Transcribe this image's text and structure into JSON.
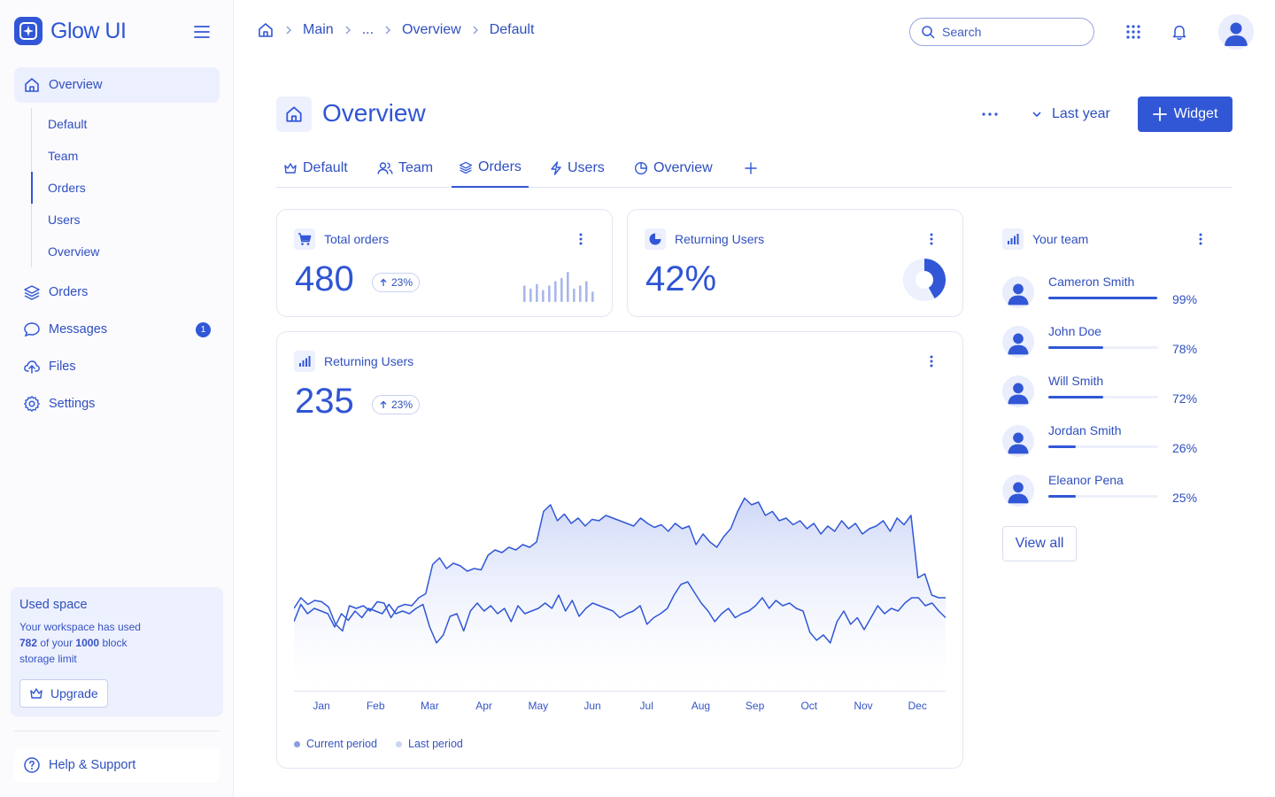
{
  "app": {
    "name": "Glow UI"
  },
  "sidebar": {
    "nav": [
      {
        "label": "Overview",
        "icon": "home-icon",
        "active": true
      },
      {
        "label": "Orders",
        "icon": "layers-icon"
      },
      {
        "label": "Messages",
        "icon": "chat-icon",
        "badge": "1"
      },
      {
        "label": "Files",
        "icon": "upload-cloud-icon"
      },
      {
        "label": "Settings",
        "icon": "gear-icon"
      }
    ],
    "sub": [
      "Default",
      "Team",
      "Orders",
      "Users",
      "Overview"
    ],
    "storage": {
      "title": "Used space",
      "text_before": "Your workspace has used",
      "used": "782",
      "text_mid": "of your",
      "limit": "1000",
      "text_after": "block storage limit",
      "upgrade_label": "Upgrade"
    },
    "help_label": "Help & Support"
  },
  "topbar": {
    "breadcrumb": [
      "Main",
      "...",
      "Overview",
      "Default"
    ],
    "search_placeholder": "Search"
  },
  "page": {
    "title": "Overview",
    "period": "Last year",
    "widget_label": "Widget",
    "tabs": [
      {
        "label": "Default",
        "icon": "crown-icon"
      },
      {
        "label": "Team",
        "icon": "users-icon"
      },
      {
        "label": "Orders",
        "icon": "layers-icon",
        "active": true
      },
      {
        "label": "Users",
        "icon": "bolt-icon"
      },
      {
        "label": "Overview",
        "icon": "pie-icon"
      }
    ]
  },
  "cards": {
    "total_orders": {
      "title": "Total orders",
      "value": "480",
      "delta": "23%",
      "bars": [
        0.55,
        0.45,
        0.6,
        0.4,
        0.55,
        0.7,
        0.8,
        1.0,
        0.45,
        0.55,
        0.7,
        0.35
      ]
    },
    "returning_users": {
      "title": "Returning Users",
      "value": "42%",
      "fraction": 0.42
    },
    "returning_chart": {
      "title": "Returning Users",
      "value": "235",
      "delta": "23%"
    }
  },
  "chart_data": {
    "type": "area",
    "categories": [
      "Jan",
      "Feb",
      "Mar",
      "Apr",
      "May",
      "Jun",
      "Jul",
      "Aug",
      "Sep",
      "Oct",
      "Nov",
      "Dec"
    ],
    "series": [
      {
        "name": "Current period",
        "values": [
          62,
          70,
          65,
          68,
          67,
          63,
          50,
          45,
          64,
          62,
          64,
          60,
          67,
          66,
          55,
          63,
          65,
          64,
          70,
          73,
          95,
          100,
          92,
          96,
          94,
          90,
          92,
          91,
          102,
          106,
          104,
          108,
          106,
          110,
          108,
          112,
          135,
          140,
          128,
          133,
          126,
          130,
          124,
          129,
          128,
          132,
          130,
          128,
          126,
          124,
          130,
          126,
          123,
          125,
          120,
          126,
          122,
          124,
          110,
          118,
          112,
          108,
          116,
          122,
          135,
          145,
          140,
          142,
          132,
          135,
          128,
          130,
          125,
          128,
          122,
          126,
          118,
          124,
          120,
          128,
          122,
          126,
          118,
          122,
          124,
          128,
          120,
          130,
          125,
          132,
          85,
          88,
          72,
          70,
          70
        ]
      },
      {
        "name": "Last period",
        "values": [
          52,
          65,
          58,
          62,
          60,
          58,
          48,
          58,
          53,
          60,
          55,
          62,
          60,
          58,
          65,
          58,
          60,
          58,
          62,
          65,
          48,
          36,
          42,
          56,
          58,
          45,
          60,
          66,
          60,
          64,
          58,
          62,
          52,
          64,
          58,
          60,
          62,
          66,
          62,
          72,
          60,
          68,
          56,
          62,
          66,
          64,
          62,
          60,
          55,
          58,
          60,
          64,
          50,
          55,
          58,
          62,
          72,
          80,
          82,
          74,
          66,
          60,
          52,
          58,
          62,
          55,
          58,
          60,
          64,
          70,
          62,
          68,
          64,
          66,
          62,
          60,
          44,
          38,
          42,
          36,
          52,
          60,
          50,
          55,
          46,
          55,
          64,
          58,
          62,
          60,
          66,
          70,
          70,
          64,
          66,
          60,
          55
        ]
      }
    ],
    "ylim": [
      0,
      200
    ],
    "legend_position": "bottom-left"
  },
  "team": {
    "title": "Your team",
    "members": [
      {
        "name": "Cameron Smith",
        "pct": "99%",
        "value": 0.99
      },
      {
        "name": "John Doe",
        "pct": "78%",
        "value": 0.5
      },
      {
        "name": "Will Smith",
        "pct": "72%",
        "value": 0.5
      },
      {
        "name": "Jordan Smith",
        "pct": "26%",
        "value": 0.25
      },
      {
        "name": "Eleanor Pena",
        "pct": "25%",
        "value": 0.25
      }
    ],
    "view_all": "View all"
  },
  "colors": {
    "accent": "#3157d6",
    "text": "#2f4fbf",
    "soft": "#edf0fd"
  }
}
